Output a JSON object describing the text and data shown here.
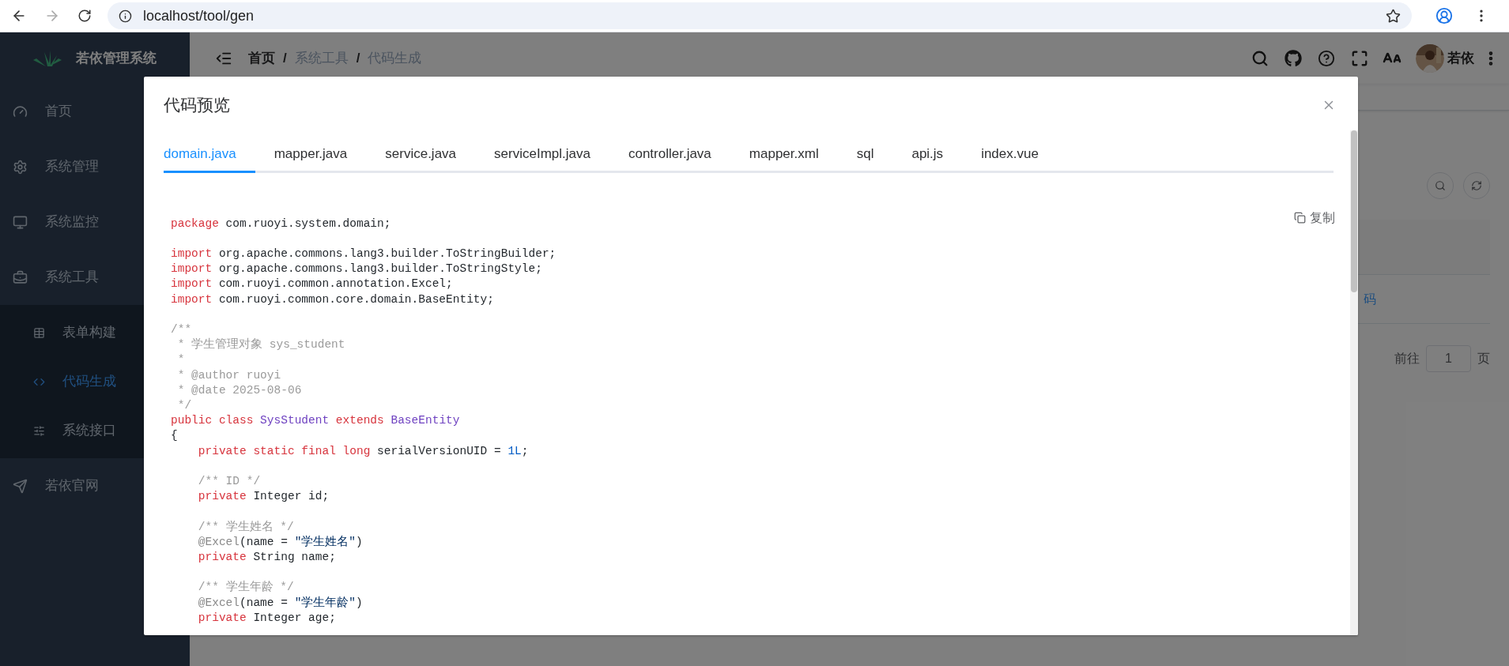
{
  "browser": {
    "url": "localhost/tool/gen"
  },
  "sidebar": {
    "title": "若依管理系统",
    "items": [
      {
        "label": "首页",
        "selected": false
      },
      {
        "label": "系统管理",
        "selected": false
      },
      {
        "label": "系统监控",
        "selected": false
      },
      {
        "label": "系统工具",
        "selected": false,
        "children": [
          {
            "label": "表单构建",
            "selected": false
          },
          {
            "label": "代码生成",
            "selected": true
          },
          {
            "label": "系统接口",
            "selected": false
          }
        ]
      },
      {
        "label": "若依官网",
        "selected": false
      }
    ]
  },
  "header": {
    "separator": "/",
    "breadcrumb": [
      {
        "label": "首页",
        "link": true
      },
      {
        "label": "系统工具",
        "link": false
      },
      {
        "label": "代码生成",
        "link": false
      }
    ],
    "user": "若依"
  },
  "background": {
    "link_fragment": "码",
    "pagination": {
      "goto_label": "前往",
      "page": "1",
      "unit": "页"
    }
  },
  "dialog": {
    "title": "代码预览",
    "copy_label": "复制",
    "tabs": [
      {
        "label": "domain.java",
        "selected": true
      },
      {
        "label": "mapper.java",
        "selected": false
      },
      {
        "label": "service.java",
        "selected": false
      },
      {
        "label": "serviceImpl.java",
        "selected": false
      },
      {
        "label": "controller.java",
        "selected": false
      },
      {
        "label": "mapper.xml",
        "selected": false
      },
      {
        "label": "sql",
        "selected": false
      },
      {
        "label": "api.js",
        "selected": false
      },
      {
        "label": "index.vue",
        "selected": false
      }
    ],
    "code_blocks": [
      [
        [
          {
            "kind": "keyword",
            "text": "package"
          },
          {
            "kind": "plain",
            "text": " com.ruoyi.system.domain;"
          }
        ]
      ],
      [
        [
          {
            "kind": "keyword",
            "text": "import"
          },
          {
            "kind": "plain",
            "text": " org.apache.commons.lang3.builder.ToStringBuilder;"
          }
        ],
        [
          {
            "kind": "keyword",
            "text": "import"
          },
          {
            "kind": "plain",
            "text": " org.apache.commons.lang3.builder.ToStringStyle;"
          }
        ],
        [
          {
            "kind": "keyword",
            "text": "import"
          },
          {
            "kind": "plain",
            "text": " com.ruoyi.common.annotation.Excel;"
          }
        ],
        [
          {
            "kind": "keyword",
            "text": "import"
          },
          {
            "kind": "plain",
            "text": " com.ruoyi.common.core.domain.BaseEntity;"
          }
        ]
      ],
      [
        [
          {
            "kind": "comment",
            "text": "/**"
          }
        ],
        [
          {
            "kind": "comment",
            "text": " * 学生管理对象 sys_student"
          }
        ],
        [
          {
            "kind": "comment",
            "text": " *"
          }
        ],
        [
          {
            "kind": "comment",
            "text": " * @author ruoyi"
          }
        ],
        [
          {
            "kind": "comment",
            "text": " * @date 2025-08-06"
          }
        ],
        [
          {
            "kind": "comment",
            "text": " */"
          }
        ],
        [
          {
            "kind": "keyword",
            "text": "public class"
          },
          {
            "kind": "type",
            "text": " SysStudent"
          },
          {
            "kind": "keyword",
            "text": " extends"
          },
          {
            "kind": "type",
            "text": " BaseEntity"
          }
        ],
        [
          {
            "kind": "plain",
            "text": "{"
          }
        ],
        [
          {
            "kind": "keyword",
            "text": "    private static final long"
          },
          {
            "kind": "plain",
            "text": " serialVersionUID = "
          },
          {
            "kind": "number",
            "text": "1L"
          },
          {
            "kind": "plain",
            "text": ";"
          }
        ]
      ],
      [
        [
          {
            "kind": "comment",
            "text": "    /** ID */"
          }
        ],
        [
          {
            "kind": "keyword",
            "text": "    private"
          },
          {
            "kind": "plain",
            "text": " Integer id;"
          }
        ]
      ],
      [
        [
          {
            "kind": "comment",
            "text": "    /** 学生姓名 */"
          }
        ],
        [
          {
            "kind": "annotation",
            "text": "    @Excel"
          },
          {
            "kind": "plain",
            "text": "(name = "
          },
          {
            "kind": "string",
            "text": "\"学生姓名\""
          },
          {
            "kind": "plain",
            "text": ")"
          }
        ],
        [
          {
            "kind": "keyword",
            "text": "    private"
          },
          {
            "kind": "plain",
            "text": " String name;"
          }
        ]
      ],
      [
        [
          {
            "kind": "comment",
            "text": "    /** 学生年龄 */"
          }
        ],
        [
          {
            "kind": "annotation",
            "text": "    @Excel"
          },
          {
            "kind": "plain",
            "text": "(name = "
          },
          {
            "kind": "string",
            "text": "\"学生年龄\""
          },
          {
            "kind": "plain",
            "text": ")"
          }
        ],
        [
          {
            "kind": "keyword",
            "text": "    private"
          },
          {
            "kind": "plain",
            "text": " Integer age;"
          }
        ]
      ]
    ]
  }
}
